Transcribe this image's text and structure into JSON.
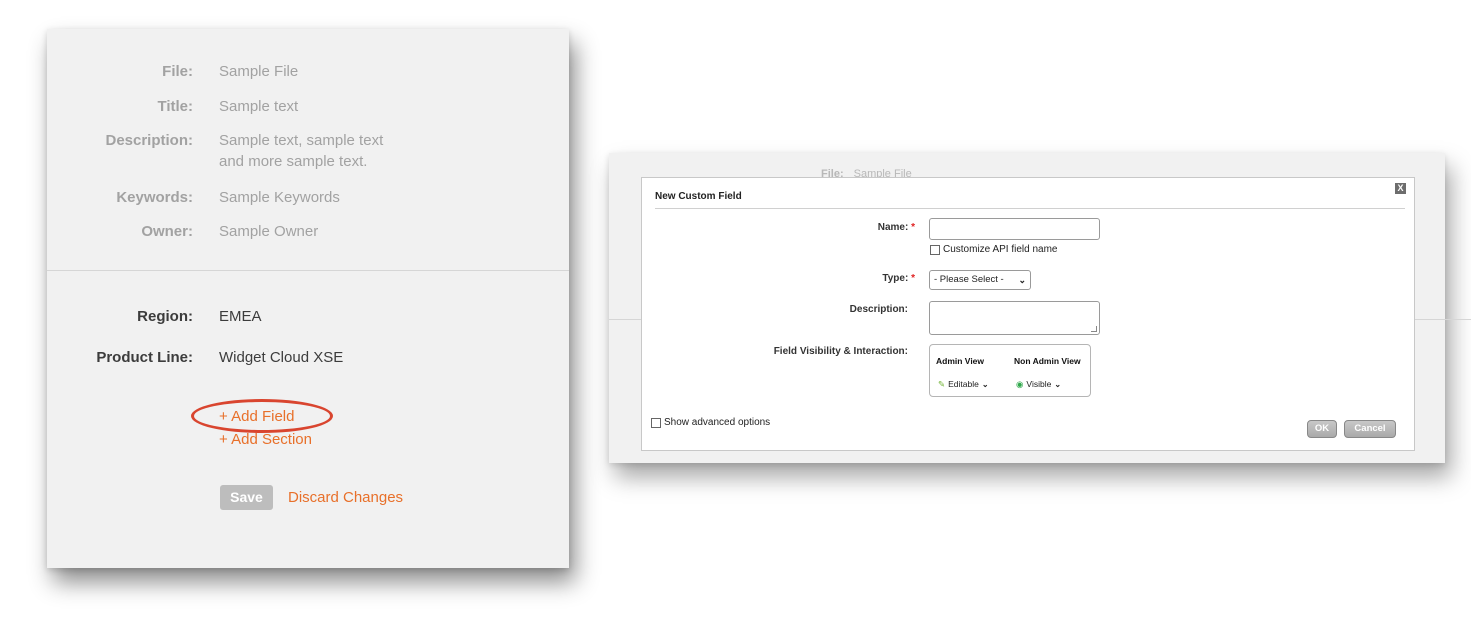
{
  "left": {
    "fields": [
      {
        "label": "File:",
        "value": "Sample File"
      },
      {
        "label": "Title:",
        "value": "Sample text"
      },
      {
        "label": "Description:",
        "value_line1": "Sample text, sample text",
        "value_line2": "and more sample text."
      },
      {
        "label": "Keywords:",
        "value": "Sample Keywords"
      },
      {
        "label": "Owner:",
        "value": "Sample Owner"
      }
    ],
    "region": {
      "label": "Region:",
      "value": "EMEA"
    },
    "product_line": {
      "label": "Product Line:",
      "value": "Widget Cloud XSE"
    },
    "add_field": "+ Add Field",
    "add_section": "+ Add Section",
    "save": "Save",
    "discard": "Discard Changes",
    "highlight_color": "#d9452f",
    "link_color": "#e8702a"
  },
  "ghost": {
    "label": "File:",
    "value": "Sample File"
  },
  "dialog": {
    "title": "New Custom Field",
    "close_glyph": "X",
    "name_label": "Name:",
    "required_mark": "*",
    "name_value": "",
    "customize_api": "Customize API field name",
    "type_label": "Type:",
    "type_selected": "- Please Select -",
    "description_label": "Description:",
    "visibility_label": "Field Visibility & Interaction:",
    "admin_view_header": "Admin View",
    "non_admin_view_header": "Non Admin View",
    "admin_view_value": "Editable",
    "non_admin_view_value": "Visible",
    "show_advanced": "Show advanced options",
    "ok": "OK",
    "cancel": "Cancel"
  }
}
